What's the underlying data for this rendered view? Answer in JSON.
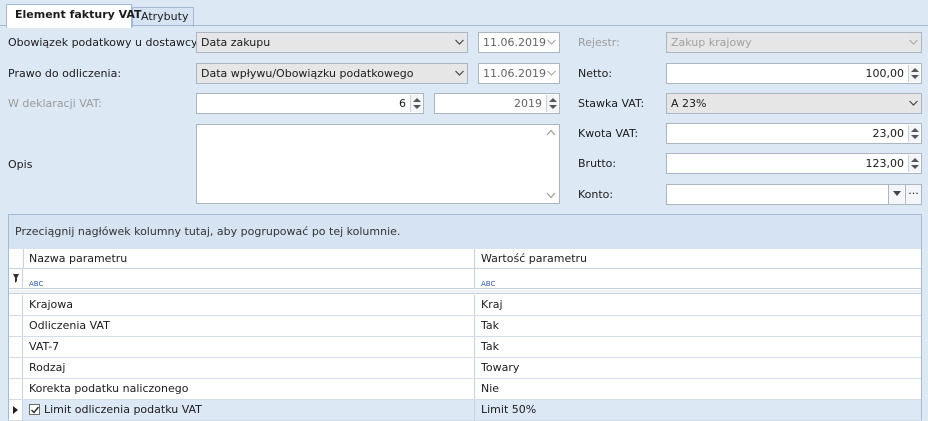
{
  "tabs": [
    {
      "label": "Element faktury VAT",
      "active": true
    },
    {
      "label": "Atrybuty",
      "active": false
    }
  ],
  "form": {
    "obowiazek_label": "Obowiązek podatkowy u dostawcy:",
    "obowiazek_value": "Data zakupu",
    "obowiazek_date": "11.06.2019",
    "prawo_label": "Prawo do odliczenia:",
    "prawo_value": "Data wpływu/Obowiązku podatkowego",
    "prawo_date": "11.06.2019",
    "deklaracja_label": "W deklaracji VAT:",
    "deklaracja_month": "6",
    "deklaracja_year": "2019",
    "opis_label": "Opis",
    "opis_value": "",
    "rejestr_label": "Rejestr:",
    "rejestr_value": "Zakup krajowy",
    "netto_label": "Netto:",
    "netto_value": "100,00",
    "stawka_label": "Stawka VAT:",
    "stawka_value": "A 23%",
    "kwota_label": "Kwota VAT:",
    "kwota_value": "23,00",
    "brutto_label": "Brutto:",
    "brutto_value": "123,00",
    "konto_label": "Konto:",
    "konto_value": "",
    "konto_more": "···"
  },
  "grid": {
    "group_hint": "Przeciągnij nagłówek kolumny tutaj, aby pogrupować po tej kolumnie.",
    "columns": [
      "Nazwa parametru",
      "Wartość parametru"
    ],
    "filter_glyph": "ABC",
    "rows": [
      {
        "name": "Krajowa",
        "value": "Kraj"
      },
      {
        "name": "Odliczenia VAT",
        "value": "Tak"
      },
      {
        "name": "VAT-7",
        "value": "Tak"
      },
      {
        "name": "Rodzaj",
        "value": "Towary"
      },
      {
        "name": "Korekta podatku naliczonego",
        "value": "Nie"
      },
      {
        "name": "Limit odliczenia podatku VAT",
        "value": "Limit 50%",
        "checkbox": true,
        "checked": true
      }
    ]
  },
  "colors": {
    "background": "#dde8f5",
    "border": "#a4bbd6",
    "accent": "#2d5fa8"
  }
}
